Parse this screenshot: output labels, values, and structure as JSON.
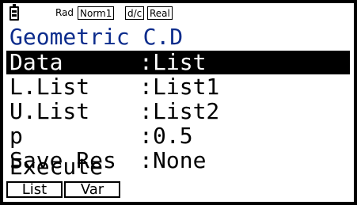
{
  "status_bar": {
    "battery_icon": "battery-icon",
    "angle_mode": "Rad",
    "display_mode": "Norm1",
    "fraction_mode": "d/c",
    "complex_mode": "Real"
  },
  "screen": {
    "title": "Geometric C.D",
    "rows": [
      {
        "label": "Data",
        "sep": ":",
        "value": "List",
        "selected": true
      },
      {
        "label": "L.List",
        "sep": ":",
        "value": "List1",
        "selected": false
      },
      {
        "label": "U.List",
        "sep": ":",
        "value": "List2",
        "selected": false
      },
      {
        "label": "p",
        "sep": ":",
        "value": "0.5",
        "selected": false
      },
      {
        "label": "Save Res",
        "sep": ":",
        "value": "None",
        "selected": false
      },
      {
        "label": "Execute",
        "sep": "",
        "value": "",
        "selected": false
      }
    ]
  },
  "function_keys": {
    "f1": "List",
    "f2": "Var"
  },
  "colors": {
    "title": "#0c2c8c",
    "highlight_bg": "#000000",
    "highlight_fg": "#ffffff"
  }
}
